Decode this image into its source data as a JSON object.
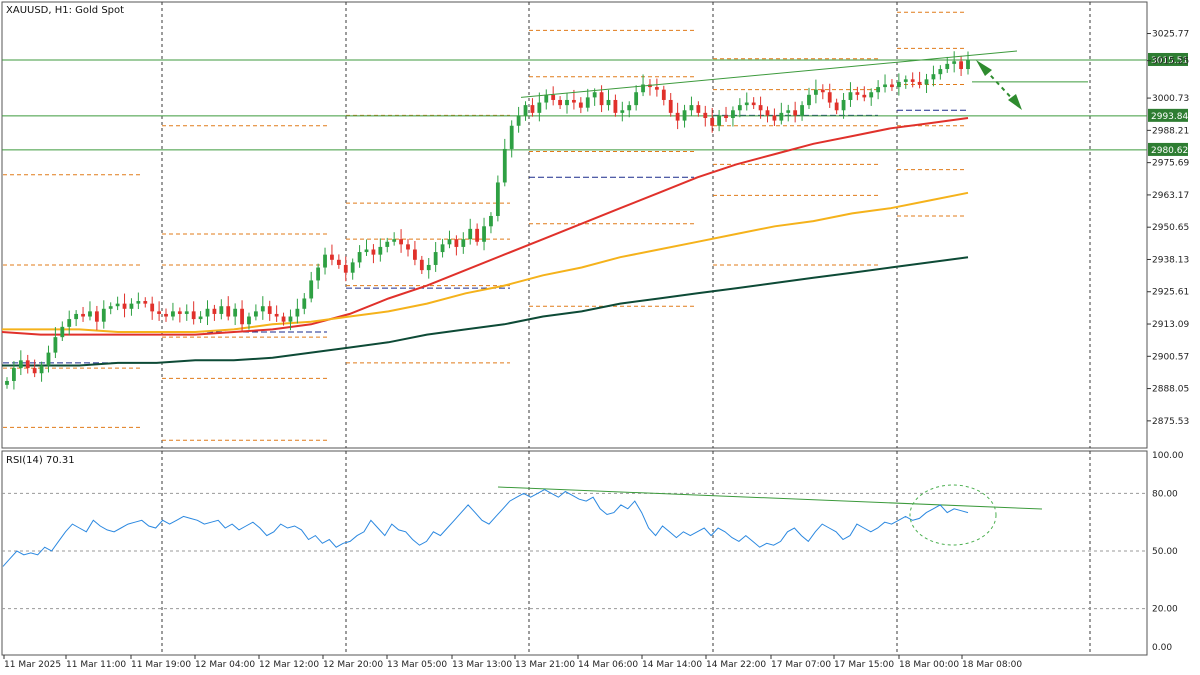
{
  "colors": {
    "background": "#ffffff",
    "grid": "#3a3a3a",
    "bull": "#2ea043",
    "bear": "#e0312b",
    "ma_fast": "#e0312b",
    "ma_mid": "#f5b21b",
    "ma_slow": "#0d4a36",
    "pivot": "#e07b1a",
    "pivot_mid": "#1a2a8c",
    "level_line": "#3c9a3c",
    "rsi_line": "#2b88e0",
    "trendline": "#3c9a3c",
    "price_badge": "#2e7d32",
    "current_marker": "#e0312b"
  },
  "chart_data": [
    {
      "type": "candlestick",
      "title": "XAUUSD, H1:  Gold Spot",
      "symbol": "XAUUSD",
      "timeframe": "H1",
      "description": "Gold Spot",
      "ylim": [
        2865,
        3038
      ],
      "y_ticks": [
        "3025.77",
        "3015.25",
        "3000.73",
        "2988.21",
        "2975.69",
        "2963.17",
        "2950.65",
        "2938.13",
        "2925.61",
        "2913.09",
        "2900.57",
        "2888.05",
        "2875.53"
      ],
      "x_ticks": [
        "11 Mar 2025",
        "11 Mar 11:00",
        "11 Mar 19:00",
        "12 Mar 04:00",
        "12 Mar 12:00",
        "12 Mar 20:00",
        "13 Mar 05:00",
        "13 Mar 13:00",
        "13 Mar 21:00",
        "14 Mar 06:00",
        "14 Mar 14:00",
        "14 Mar 22:00",
        "17 Mar 07:00",
        "17 Mar 15:00",
        "18 Mar 00:00",
        "18 Mar 08:00"
      ],
      "close_path": [
        2891,
        2896,
        2899,
        2896,
        2894,
        2897,
        2902,
        2908,
        2912,
        2915,
        2917,
        2916,
        2918,
        2914,
        2919,
        2920,
        2921,
        2919,
        2921,
        2922,
        2921,
        2918,
        2917,
        2916,
        2918,
        2917,
        2918,
        2915,
        2916,
        2919,
        2917,
        2920,
        2916,
        2919,
        2913,
        2916,
        2918,
        2920,
        2917,
        2916,
        2914,
        2916,
        2919,
        2923,
        2930,
        2935,
        2940,
        2938,
        2936,
        2933,
        2937,
        2941,
        2942,
        2940,
        2943,
        2945,
        2946,
        2944,
        2942,
        2938,
        2934,
        2936,
        2941,
        2944,
        2946,
        2943,
        2946,
        2950,
        2945,
        2951,
        2955,
        2968,
        2981,
        2990,
        2994,
        2998,
        2995,
        2999,
        3002,
        3000,
        2998,
        3000,
        2999,
        2997,
        3001,
        3003,
        2998,
        3000,
        2995,
        2996,
        2998,
        3003,
        3006,
        3005,
        3004,
        3000,
        2995,
        2992,
        2996,
        2998,
        2995,
        2993,
        2990,
        2994,
        2993,
        2996,
        2998,
        2999,
        2998,
        2996,
        2994,
        2992,
        2995,
        2996,
        2994,
        2998,
        3002,
        3004,
        3003,
        2999,
        2996,
        3000,
        3003,
        3002,
        3001,
        3003,
        3005,
        3006,
        3005,
        3007,
        3008,
        3007,
        3006,
        3008,
        3010,
        3012,
        3014,
        3015,
        3012,
        3015.51
      ],
      "moving_averages": [
        {
          "name": "MA fast",
          "values": [
            2910,
            2909,
            2909,
            2909,
            2909,
            2909,
            2910,
            2911,
            2913,
            2917,
            2923,
            2928,
            2934,
            2940,
            2946,
            2952,
            2958,
            2964,
            2970,
            2975,
            2979,
            2983,
            2986,
            2989,
            2991,
            2993
          ]
        },
        {
          "name": "MA mid",
          "values": [
            2911,
            2911,
            2911,
            2910,
            2910,
            2910,
            2911,
            2913,
            2914,
            2916,
            2918,
            2921,
            2925,
            2928,
            2932,
            2935,
            2939,
            2942,
            2945,
            2948,
            2951,
            2953,
            2956,
            2958,
            2961,
            2964
          ]
        },
        {
          "name": "MA slow",
          "values": [
            2897,
            2897,
            2897,
            2898,
            2898,
            2899,
            2899,
            2900,
            2902,
            2904,
            2906,
            2909,
            2911,
            2913,
            2916,
            2918,
            2921,
            2923,
            2925,
            2927,
            2929,
            2931,
            2933,
            2935,
            2937,
            2939
          ]
        }
      ],
      "levels": [
        {
          "value": "3015.51",
          "label": "3015.51"
        },
        {
          "value": "2993.84",
          "label": "2993.84"
        },
        {
          "value": "2980.62",
          "label": "2980.62"
        }
      ]
    },
    {
      "type": "line",
      "title": "RSI(14) 70.31",
      "indicator": "RSI(14)",
      "current_value": "70.31",
      "ylim": [
        0,
        100
      ],
      "y_ticks": [
        "100.00",
        "80.00",
        "50.00",
        "20.00",
        "0.00"
      ],
      "values": [
        42,
        46,
        50,
        48,
        49,
        48,
        52,
        50,
        55,
        60,
        64,
        62,
        60,
        66,
        63,
        61,
        60,
        62,
        64,
        65,
        66,
        63,
        62,
        66,
        64,
        66,
        68,
        67,
        66,
        64,
        65,
        66,
        62,
        64,
        61,
        63,
        65,
        62,
        58,
        60,
        64,
        62,
        63,
        61,
        56,
        58,
        54,
        56,
        52,
        54,
        55,
        58,
        60,
        66,
        62,
        58,
        64,
        61,
        60,
        56,
        53,
        55,
        60,
        58,
        62,
        66,
        70,
        74,
        70,
        66,
        64,
        68,
        72,
        76,
        78,
        80,
        78,
        80,
        82,
        80,
        78,
        81,
        79,
        77,
        76,
        78,
        72,
        69,
        70,
        74,
        72,
        76,
        70,
        62,
        58,
        63,
        60,
        57,
        60,
        58,
        60,
        62,
        58,
        62,
        60,
        57,
        55,
        58,
        55,
        52,
        54,
        53,
        55,
        60,
        62,
        58,
        55,
        60,
        64,
        62,
        60,
        56,
        58,
        64,
        62,
        60,
        62,
        65,
        64,
        66,
        68,
        66,
        67,
        70,
        72,
        74,
        70,
        72,
        71,
        70
      ]
    }
  ]
}
